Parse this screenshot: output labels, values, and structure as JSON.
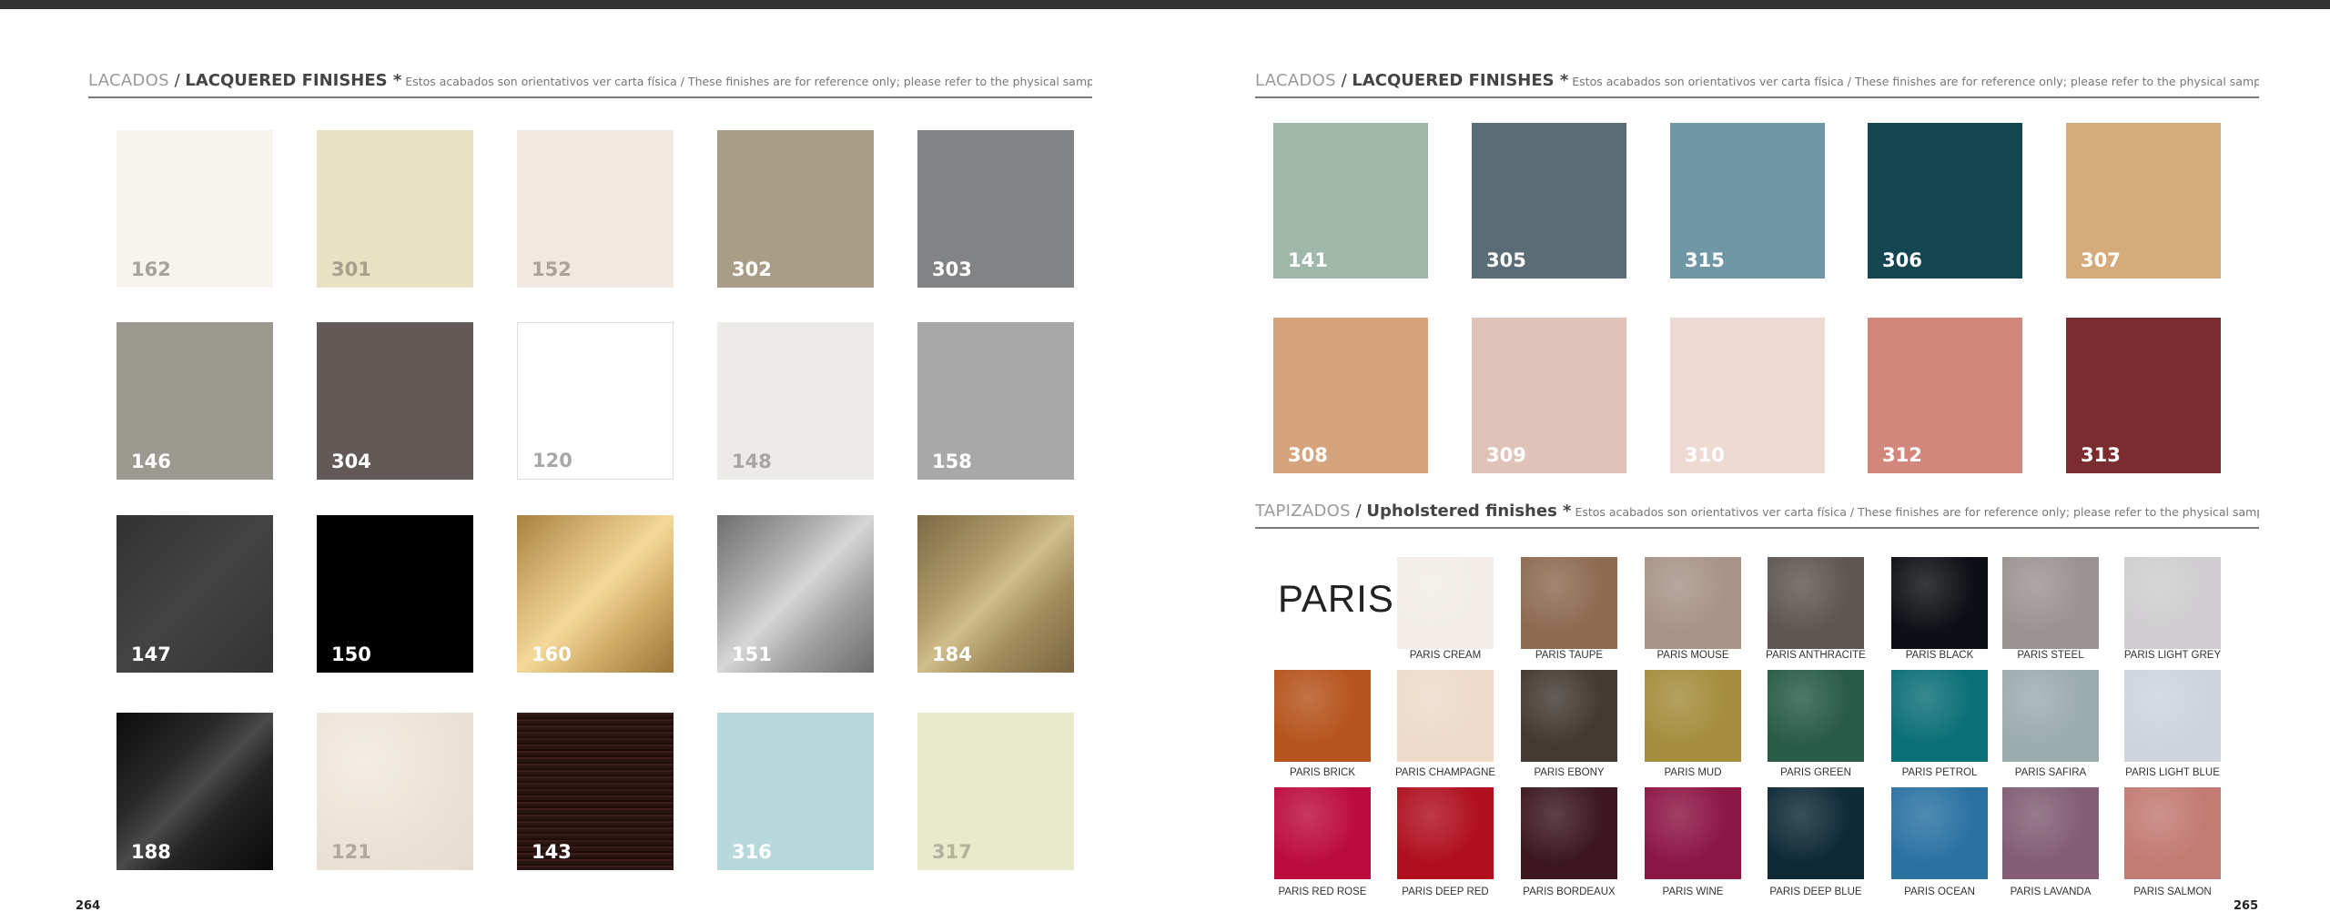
{
  "page": {
    "left_number": "264",
    "right_number": "265"
  },
  "headings": {
    "left": {
      "es": "LACADOS",
      "sep": " / ",
      "en": "LACQUERED FINISHES *",
      "note": " Estos acabados son orientativos ver carta física / These finishes are for reference only; please refer to the physical sample chart"
    },
    "right": {
      "es": "LACADOS",
      "sep": " / ",
      "en": "LACQUERED FINISHES *",
      "note": " Estos acabados son orientativos ver carta física / These finishes are for reference only; please refer to the physical sample chart"
    },
    "upholstered": {
      "es": "TAPIZADOS",
      "sep": " / ",
      "en": "Upholstered finishes *",
      "note": " Estos acabados son orientativos ver carta física / These finishes are for reference only; please refer to the physical sample chart"
    }
  },
  "lacquered_left": [
    {
      "code": "162",
      "color": "#f7f4ef",
      "text_color": "#a8a39a"
    },
    {
      "code": "301",
      "color": "#e8e1c3",
      "text_color": "#a8a08a"
    },
    {
      "code": "152",
      "color": "#f0e8e1",
      "text_color": "#aaa29b"
    },
    {
      "code": "302",
      "color": "#a89d87",
      "text_color": "#ffffff"
    },
    {
      "code": "303",
      "color": "#828385",
      "text_color": "#ffffff"
    },
    {
      "code": "146",
      "color": "#9c9990",
      "text_color": "#ffffff"
    },
    {
      "code": "304",
      "color": "#635a57",
      "text_color": "#ffffff"
    },
    {
      "code": "120",
      "color": "#ffffff",
      "text_color": "#a8a8a8"
    },
    {
      "code": "148",
      "color": "#ecebe8",
      "text_color": "#a8a6a2"
    },
    {
      "code": "158",
      "color": "#a8a8a8",
      "text_color": "#ffffff"
    },
    {
      "code": "147",
      "color": "#3b3b3c",
      "text_color": "#ffffff"
    },
    {
      "code": "150",
      "color": "#000000",
      "text_color": "#ffffff"
    },
    {
      "code": "160",
      "color": "#c9a363",
      "text_color": "#ffffff"
    },
    {
      "code": "151",
      "color": "#a9a9a9",
      "text_color": "#ffffff"
    },
    {
      "code": "184",
      "color": "#a58f5c",
      "text_color": "#ffffff"
    },
    {
      "code": "188",
      "color": "#1e1e1e",
      "text_color": "#ffffff"
    },
    {
      "code": "121",
      "color": "#efe7dd",
      "text_color": "#b0a89f"
    },
    {
      "code": "143",
      "color": "#2b1412",
      "text_color": "#ffffff"
    },
    {
      "code": "316",
      "color": "#b8d9dc",
      "text_color": "#ffffff"
    },
    {
      "code": "317",
      "color": "#e9e9cb",
      "text_color": "#b3b29c"
    }
  ],
  "lacquered_right": [
    {
      "code": "141",
      "color": "#a0b8aa",
      "text_color": "#ffffff"
    },
    {
      "code": "305",
      "color": "#5a6c75",
      "text_color": "#ffffff"
    },
    {
      "code": "315",
      "color": "#6f97a5",
      "text_color": "#ffffff"
    },
    {
      "code": "306",
      "color": "#134651",
      "text_color": "#ffffff"
    },
    {
      "code": "307",
      "color": "#d6ab7c",
      "text_color": "#ffffff"
    },
    {
      "code": "308",
      "color": "#d6a47c",
      "text_color": "#ffffff"
    },
    {
      "code": "309",
      "color": "#dfc3b8",
      "text_color": "#ffffff"
    },
    {
      "code": "310",
      "color": "#eedad3",
      "text_color": "#ffffff"
    },
    {
      "code": "312",
      "color": "#d1877c",
      "text_color": "#ffffff"
    },
    {
      "code": "313",
      "color": "#7a2c2e",
      "text_color": "#ffffff"
    }
  ],
  "upholstered": {
    "collection": "PARIS",
    "swatches": [
      {
        "name": "PARIS CREAM",
        "color": "#f2ede8"
      },
      {
        "name": "PARIS TAUPE",
        "color": "#8d6b52"
      },
      {
        "name": "PARIS MOUSE",
        "color": "#a89387"
      },
      {
        "name": "PARIS ANTHRACITE",
        "color": "#5e5652"
      },
      {
        "name": "PARIS BLACK",
        "color": "#0d0f14"
      },
      {
        "name": "PARIS STEEL",
        "color": "#9b9392"
      },
      {
        "name": "PARIS LIGHT GREY",
        "color": "#cfcdcf"
      },
      {
        "name": "PARIS BRICK",
        "color": "#b5541c"
      },
      {
        "name": "PARIS CHAMPAGNE",
        "color": "#eedbc9"
      },
      {
        "name": "PARIS EBONY",
        "color": "#433932"
      },
      {
        "name": "PARIS MUD",
        "color": "#a48d3c"
      },
      {
        "name": "PARIS GREEN",
        "color": "#285b46"
      },
      {
        "name": "PARIS PETROL",
        "color": "#0b6f76"
      },
      {
        "name": "PARIS SAFIRA",
        "color": "#9bacae"
      },
      {
        "name": "PARIS LIGHT BLUE",
        "color": "#cdd4dc"
      },
      {
        "name": "PARIS RED ROSE",
        "color": "#bc0c3f"
      },
      {
        "name": "PARIS DEEP RED",
        "color": "#b00f1f"
      },
      {
        "name": "PARIS BORDEAUX",
        "color": "#3c1720"
      },
      {
        "name": "PARIS WINE",
        "color": "#8c1644"
      },
      {
        "name": "PARIS DEEP BLUE",
        "color": "#0e2a37"
      },
      {
        "name": "PARIS OCEAN",
        "color": "#2a72a2"
      },
      {
        "name": "PARIS LAVANDA",
        "color": "#825d74"
      },
      {
        "name": "PARIS SALMON",
        "color": "#c27b73"
      }
    ]
  }
}
